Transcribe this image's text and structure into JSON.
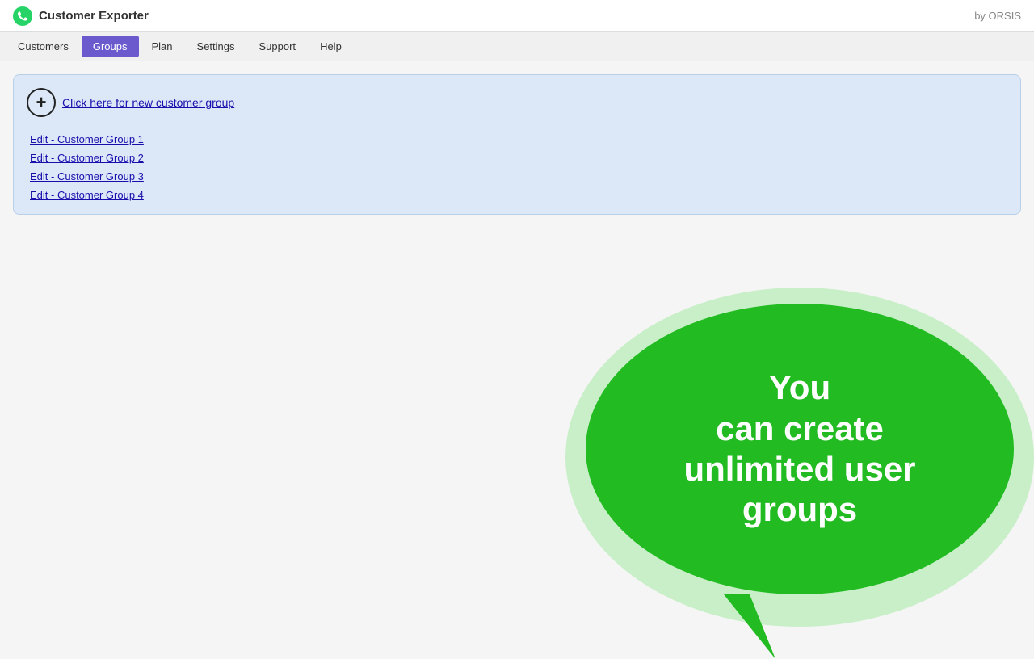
{
  "header": {
    "app_title": "Customer Exporter",
    "by_label": "by ORSIS"
  },
  "nav": {
    "items": [
      {
        "id": "customers",
        "label": "Customers",
        "active": false
      },
      {
        "id": "groups",
        "label": "Groups",
        "active": true
      },
      {
        "id": "plan",
        "label": "Plan",
        "active": false
      },
      {
        "id": "settings",
        "label": "Settings",
        "active": false
      },
      {
        "id": "support",
        "label": "Support",
        "active": false
      },
      {
        "id": "help",
        "label": "Help",
        "active": false
      }
    ]
  },
  "groups_panel": {
    "new_group_label": "Click here for new customer group",
    "groups": [
      {
        "id": "group1",
        "label": "Edit - Customer Group 1"
      },
      {
        "id": "group2",
        "label": "Edit - Customer Group 2"
      },
      {
        "id": "group3",
        "label": "Edit - Customer Group 3"
      },
      {
        "id": "group4",
        "label": "Edit - Customer Group 4"
      }
    ]
  },
  "speech_bubble": {
    "line1": "You",
    "line2": "can create",
    "line3": "unlimited user",
    "line4": "groups"
  }
}
